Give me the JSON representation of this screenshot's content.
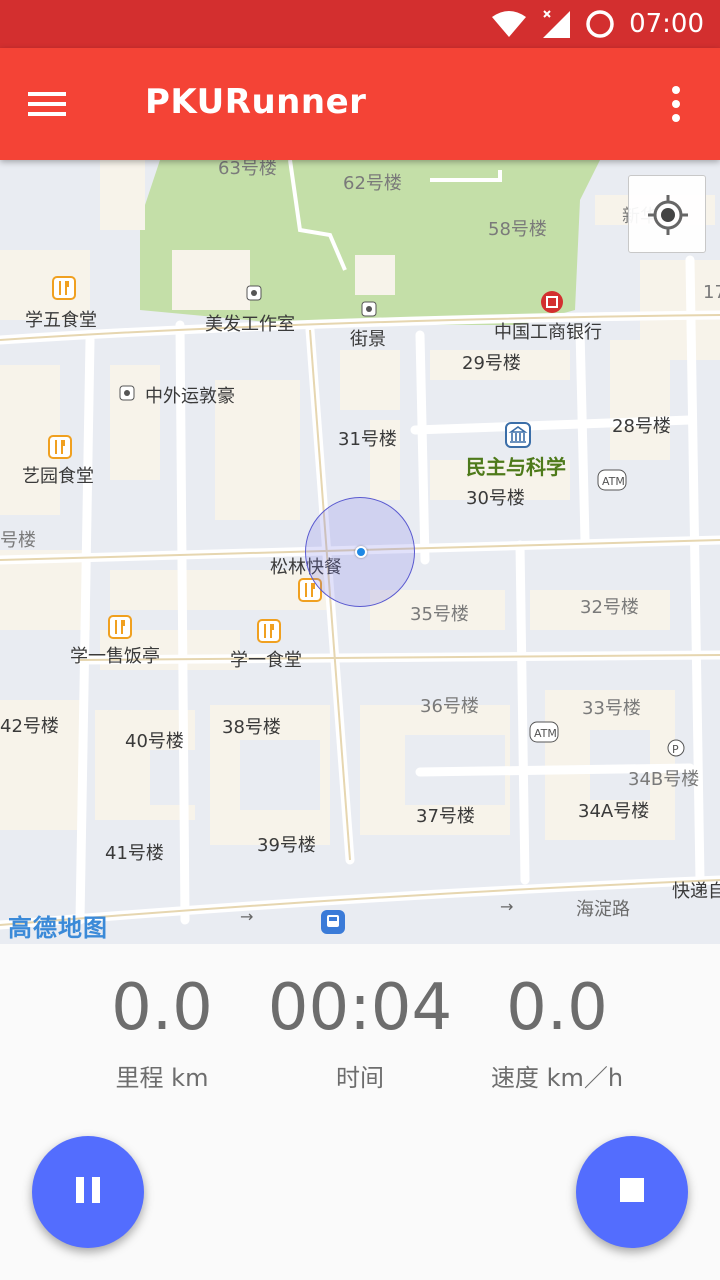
{
  "status_bar": {
    "time": "07:00",
    "icons": [
      "wifi-icon",
      "cell-signal-icon",
      "alarm-ring-icon"
    ]
  },
  "app_bar": {
    "title": "PKURunner",
    "menu_icon": "hamburger-menu-icon",
    "overflow_icon": "more-vert-icon"
  },
  "map": {
    "locate_icon": "my-location-icon",
    "logo": "高德地图",
    "labels": {
      "b63": "63号楼",
      "b62": "62号楼",
      "b58": "58号楼",
      "xinhua": "新华",
      "shop17": "17",
      "xuewu": "学五食堂",
      "meifa": "美发工作室",
      "jiejing": "街景",
      "icbc": "中国工商银行",
      "b29": "29号楼",
      "zhongwai": "中外运敦豪",
      "b31": "31号楼",
      "b28": "28号楼",
      "minzhu": "民主与科学",
      "yiyuan": "艺园食堂",
      "b30": "30号楼",
      "b_left": "号楼",
      "songlin": "松林快餐",
      "b35": "35号楼",
      "b32": "32号楼",
      "xueyi_shou": "学一售饭亭",
      "xueyi": "学一食堂",
      "b42": "42号楼",
      "b40": "40号楼",
      "b38": "38号楼",
      "b36": "36号楼",
      "b33": "33号楼",
      "b34b": "34B号楼",
      "b37": "37号楼",
      "b34a": "34A号楼",
      "b41": "41号楼",
      "b39": "39号楼",
      "kuaidi": "快递自",
      "haidian": "海淀路",
      "atm": "ATM"
    }
  },
  "stats": {
    "distance": {
      "value": "0.0",
      "label": "里程 km"
    },
    "time": {
      "value": "00:04",
      "label": "时间"
    },
    "speed": {
      "value": "0.0",
      "label": "速度 km／h"
    }
  },
  "buttons": {
    "pause_icon": "pause-icon",
    "stop_icon": "stop-icon"
  },
  "colors": {
    "status_bar": "#d32f2f",
    "app_bar": "#f44336",
    "fab": "#536dfe",
    "map_bg": "#e9ecf2",
    "park": "#c4dfa8",
    "building": "#f7f3ea"
  }
}
